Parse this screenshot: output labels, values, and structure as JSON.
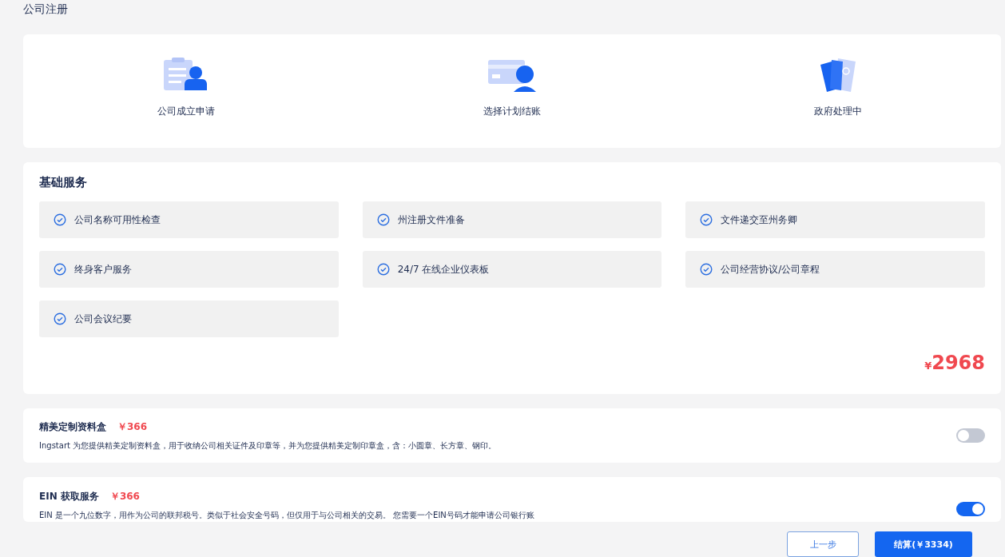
{
  "page_title": "公司注册",
  "steps": [
    {
      "kind": "application",
      "label": "公司成立申请"
    },
    {
      "kind": "checkout",
      "label": "选择计划结账"
    },
    {
      "kind": "government",
      "label": "政府处理中"
    }
  ],
  "basic_services": {
    "title": "基础服务",
    "items": [
      "公司名称可用性检查",
      "州注册文件准备",
      "文件递交至州务卿",
      "终身客户服务",
      "24/7 在线企业仪表板",
      "公司经营协议/公司章程",
      "公司会议纪要"
    ],
    "currency": "¥",
    "price": "2968"
  },
  "addons": [
    {
      "name": "精美定制资料盒",
      "price": "￥366",
      "description": "Ingstart 为您提供精美定制资料盒，用于收纳公司相关证件及印章等，并为您提供精美定制印章盒，含：小圆章、长方章、钢印。",
      "on": false
    },
    {
      "name": "EIN 获取服务",
      "price": "￥366",
      "description": "EIN 是一个九位数字，用作为公司的联邦税号。类似于社会安全号码，但仅用于与公司相关的交易。 您需要一个EIN号码才能申请公司银行账",
      "on": true
    }
  ],
  "buttons": {
    "back": "上一步",
    "checkout": "结算(￥3334)"
  }
}
